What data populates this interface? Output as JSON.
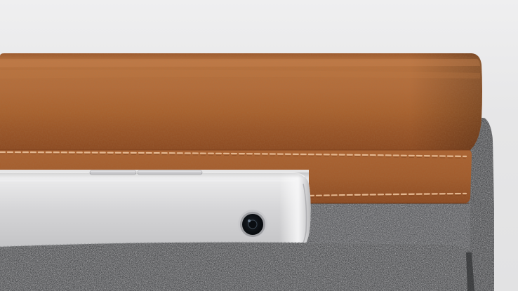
{
  "photo": {
    "subject": "",
    "colors": {
      "background": "#ececed",
      "leather": "#b06a3a",
      "leather_dark": "#8a4e27",
      "stitching": "#e0b38c",
      "felt": "#4c4d4f",
      "device_aluminum": "#d6d6d8"
    }
  }
}
